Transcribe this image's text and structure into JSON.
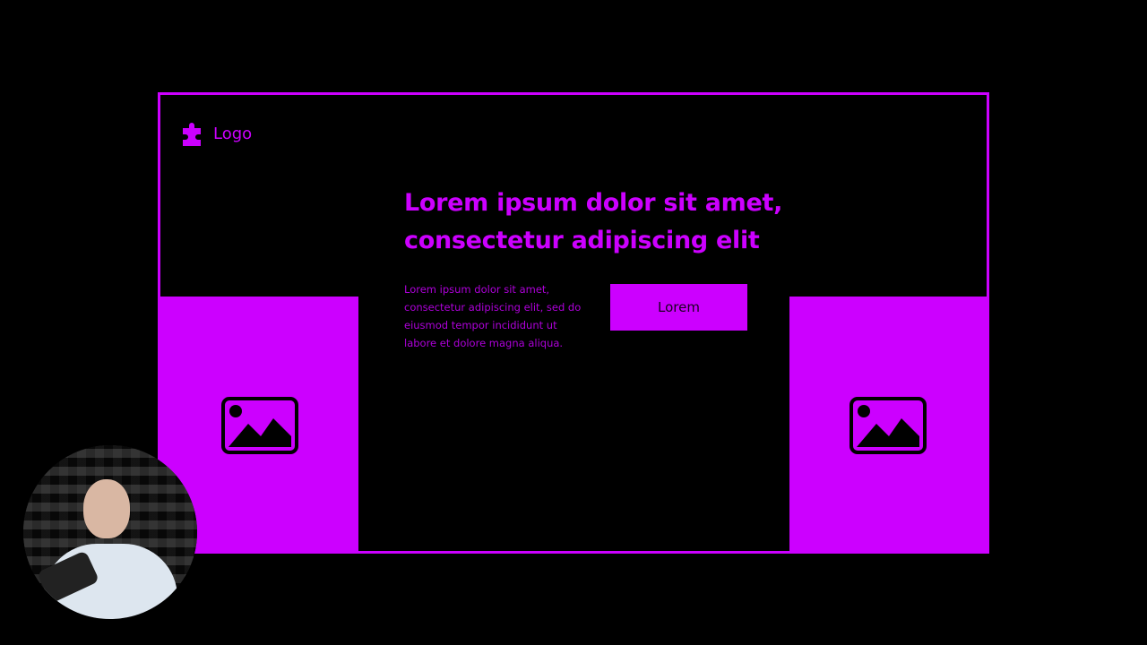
{
  "colors": {
    "accent": "#cc00ff",
    "background": "#000000"
  },
  "logo": {
    "icon": "puzzle-piece-icon",
    "label": "Logo"
  },
  "hero": {
    "headline": "Lorem ipsum dolor sit amet, consectetur adipiscing elit",
    "body": "Lorem ipsum dolor sit amet, consectetur adipiscing elit, sed do eiusmod tempor incididunt ut labore et dolore magna aliqua.",
    "cta_label": "Lorem"
  },
  "panels": {
    "left_icon": "image-placeholder-icon",
    "right_icon": "image-placeholder-icon"
  },
  "webcam": {
    "label": "presenter-webcam"
  }
}
